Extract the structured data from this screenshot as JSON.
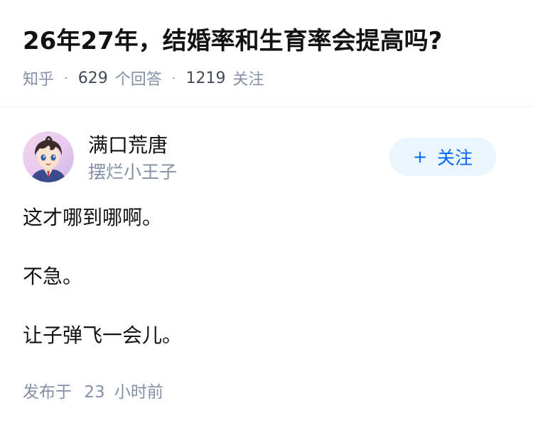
{
  "question": {
    "title": "26年27年，结婚率和生育率会提高吗?",
    "meta": {
      "source": "知乎",
      "separator": "·",
      "answer_count": "629",
      "answer_label": "个回答",
      "follower_count": "1219",
      "follower_label": "关注"
    }
  },
  "answer": {
    "author": {
      "name": "满口荒唐",
      "bio": "摆烂小王子",
      "avatar_icon": "anime-boy-avatar"
    },
    "follow_button": {
      "icon": "+",
      "label": "关注"
    },
    "paragraphs": [
      "这才哪到哪啊。",
      "不急。",
      "让子弹飞一会儿。"
    ],
    "footer": {
      "published_label": "发布于",
      "time_value": "23",
      "time_unit": "小时前"
    }
  },
  "colors": {
    "title": "#121212",
    "meta": "#8590a6",
    "accent": "#0066ff",
    "follow_bg": "#ebf5fd",
    "divider": "#ececec"
  }
}
